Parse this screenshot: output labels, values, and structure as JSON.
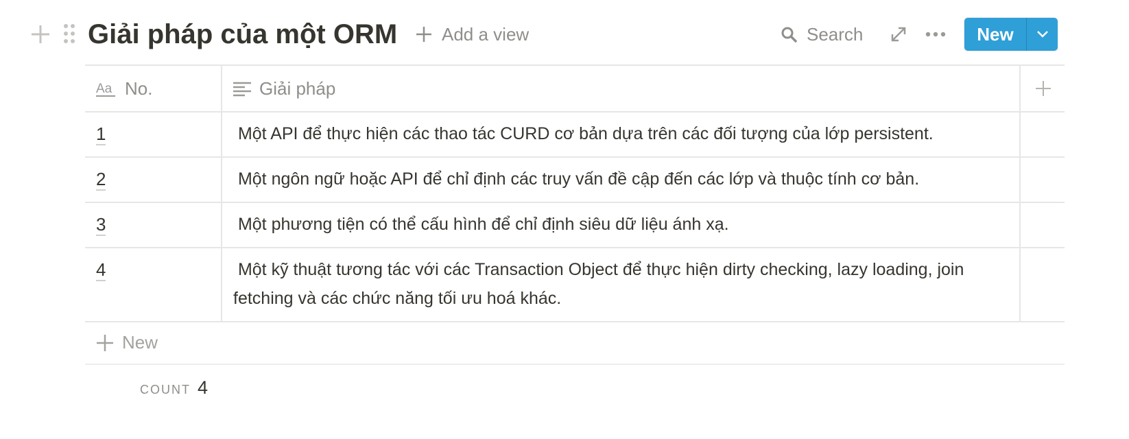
{
  "header": {
    "title": "Giải pháp của một ORM",
    "add_view_label": "Add a view",
    "search_label": "Search",
    "new_button_label": "New",
    "icons": [
      "plus-icon",
      "drag-handle-icon",
      "search-icon",
      "expand-icon",
      "more-icon",
      "chevron-down-icon"
    ]
  },
  "table": {
    "columns": [
      {
        "label": "No.",
        "icon": "title-property-icon"
      },
      {
        "label": "Giải pháp",
        "icon": "text-property-icon"
      }
    ],
    "rows": [
      {
        "no": "1",
        "solution": " Một API để thực hiện các thao tác CURD cơ bản dựa trên các đối tượng của lớp persistent."
      },
      {
        "no": "2",
        "solution": " Một ngôn ngữ hoặc API để chỉ định các truy vấn đề cập đến các lớp và thuộc tính cơ bản."
      },
      {
        "no": "3",
        "solution": " Một phương tiện có thể cấu hình để chỉ định siêu dữ liệu ánh xạ."
      },
      {
        "no": "4",
        "solution": " Một kỹ thuật tương tác với các Transaction Object để thực hiện dirty checking, lazy loading, join fetching và các chức năng tối ưu hoá khác."
      }
    ],
    "new_row_label": "New",
    "count_label": "COUNT",
    "count_value": "4"
  },
  "colors": {
    "accent": "#2f9fd8",
    "text": "#37352f",
    "muted": "#8f8e8a",
    "border": "#e6e6e4"
  }
}
